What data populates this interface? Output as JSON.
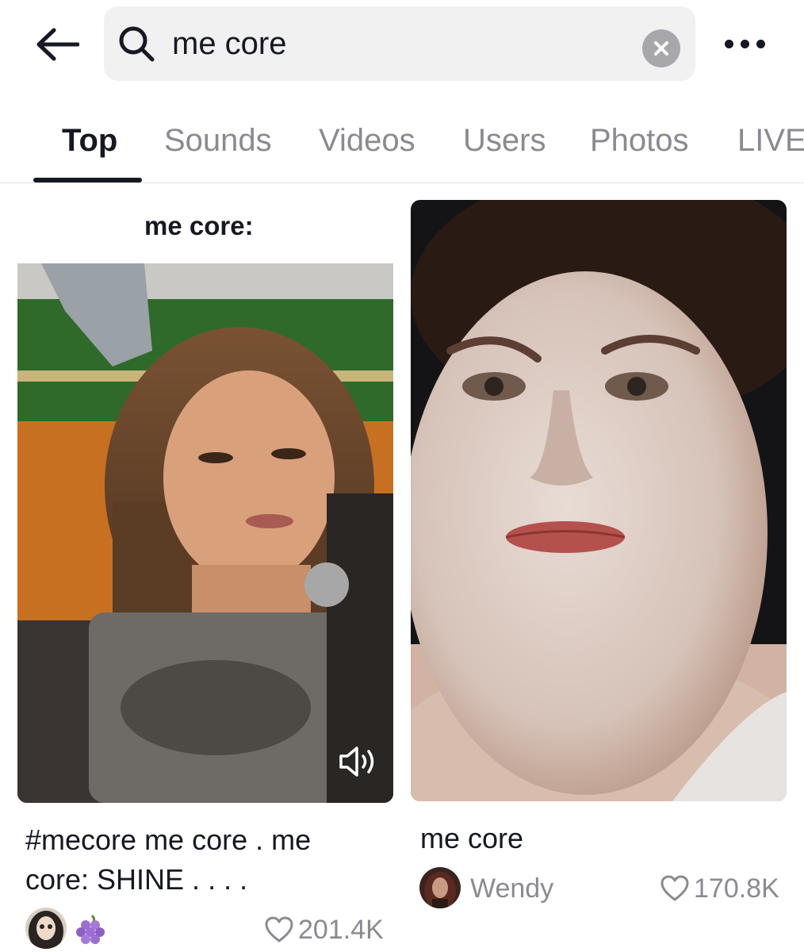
{
  "search": {
    "query": "me core"
  },
  "tabs": [
    {
      "label": "Top",
      "active": true
    },
    {
      "label": "Sounds",
      "active": false
    },
    {
      "label": "Videos",
      "active": false
    },
    {
      "label": "Users",
      "active": false
    },
    {
      "label": "Photos",
      "active": false
    },
    {
      "label": "LIVE",
      "active": false
    }
  ],
  "results": [
    {
      "overlay_caption": "me core:",
      "description": "#mecore me core . me core: SHINE  . . . .",
      "likes": "201.4K",
      "badge_icon": "grapes-icon",
      "has_sound_icon": true
    },
    {
      "description": "me core",
      "username": "Wendy",
      "likes": "170.8K"
    }
  ],
  "colors": {
    "text_primary": "#161823",
    "text_secondary": "#8a8b91",
    "search_bg": "#f1f1f2",
    "clear_button": "#a8a8ac"
  }
}
